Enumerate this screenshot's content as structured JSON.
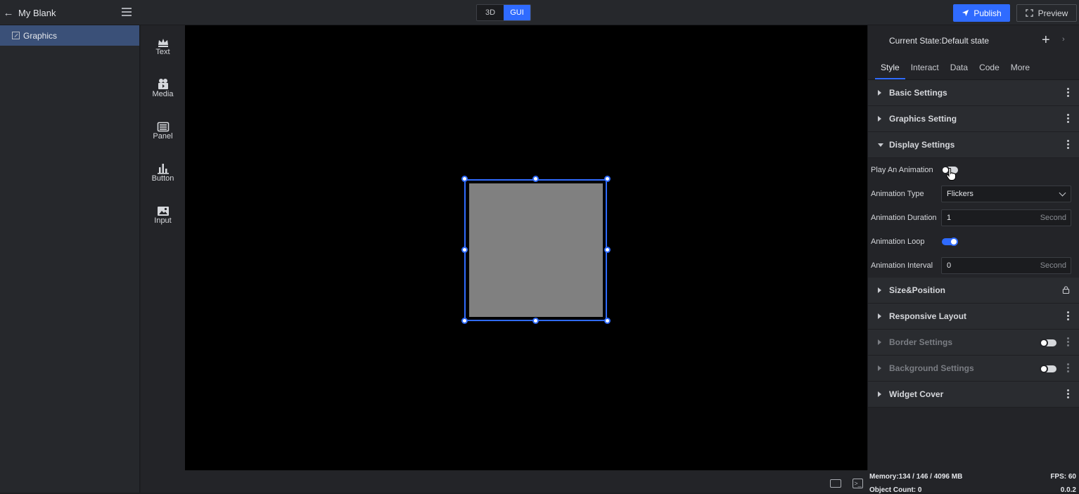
{
  "project": {
    "title": "My Blank"
  },
  "view_switch": {
    "option_3d": "3D",
    "option_gui": "GUI",
    "selected": "GUI"
  },
  "actions": {
    "publish": "Publish",
    "preview": "Preview"
  },
  "layers": [
    {
      "label": "Graphics",
      "selected": true
    }
  ],
  "toolbox": [
    {
      "label": "Text",
      "icon": "text-crown-icon"
    },
    {
      "label": "Media",
      "icon": "media-camera-icon"
    },
    {
      "label": "Panel",
      "icon": "panel-icon"
    },
    {
      "label": "Button",
      "icon": "button-chart-icon"
    },
    {
      "label": "Input",
      "icon": "input-image-icon"
    }
  ],
  "inspector": {
    "state": "Current State:Default state",
    "tabs": [
      "Style",
      "Interact",
      "Data",
      "Code",
      "More"
    ],
    "active_tab": "Style",
    "sections": {
      "basic": "Basic Settings",
      "graphics": "Graphics Setting",
      "display": "Display Settings",
      "size": "Size&Position",
      "responsive": "Responsive Layout",
      "border": "Border Settings",
      "background": "Background Settings",
      "cover": "Widget Cover"
    },
    "display": {
      "play_label": "Play An Animation",
      "play_on": false,
      "type_label": "Animation Type",
      "type_value": "Flickers",
      "duration_label": "Animation Duration",
      "duration_value": "1",
      "duration_unit": "Second",
      "loop_label": "Animation Loop",
      "loop_on": true,
      "interval_label": "Animation Interval",
      "interval_value": "0",
      "interval_unit": "Second"
    }
  },
  "status": {
    "memory": "Memory:134 / 146 / 4096 MB",
    "fps": "FPS: 60",
    "objects": "Object Count: 0",
    "version": "0.0.2"
  },
  "colors": {
    "accent": "#2f6bff",
    "widget_fill": "#808080"
  }
}
